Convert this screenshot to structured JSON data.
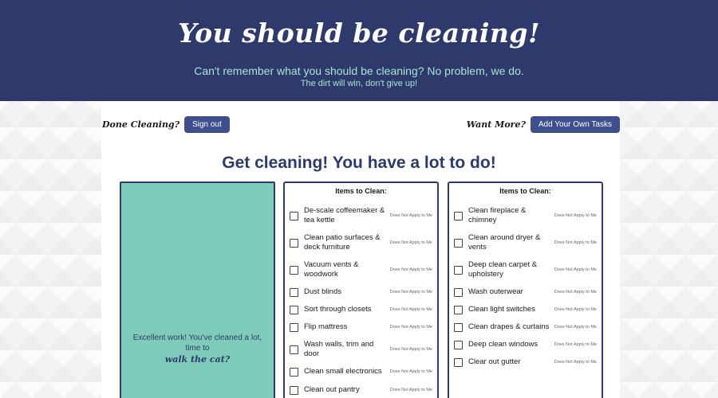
{
  "header": {
    "title": "You should be cleaning!",
    "subtitle": "Can't remember what you should be cleaning? No problem, we do.",
    "tagline": "The dirt will win, don't give up!"
  },
  "actions": {
    "done_label": "Done Cleaning?",
    "sign_out_label": "Sign out",
    "want_more_label": "Want More?",
    "add_tasks_label": "Add Your Own Tasks"
  },
  "main": {
    "heading": "Get cleaning! You have a lot to do!"
  },
  "progress_panel": {
    "message": "Excellent work! You've cleaned a lot, time to",
    "cta": "walk the cat?"
  },
  "lists": [
    {
      "title": "Items to Clean:",
      "items": [
        {
          "label": "De-scale coffeemaker & tea kettle",
          "option": "Does Not Apply to Me"
        },
        {
          "label": "Clean patio surfaces & deck furniture",
          "option": "Does Not Apply to Me"
        },
        {
          "label": "Vacuum vents & woodwork",
          "option": "Does Not Apply to Me"
        },
        {
          "label": "Dust blinds",
          "option": "Does Not Apply to Me"
        },
        {
          "label": "Sort through closets",
          "option": "Does Not Apply to Me"
        },
        {
          "label": "Flip mattress",
          "option": "Does Not Apply to Me"
        },
        {
          "label": "Wash walls, trim and door",
          "option": "Does Not Apply to Me"
        },
        {
          "label": "Clean small electronics",
          "option": "Does Not Apply to Me"
        },
        {
          "label": "Clean out pantry",
          "option": "Does Not Apply to Me"
        }
      ]
    },
    {
      "title": "Items to Clean:",
      "items": [
        {
          "label": "Clean fireplace & chimney",
          "option": "Does Not Apply to Me"
        },
        {
          "label": "Clean around dryer & vents",
          "option": "Does Not Apply to Me"
        },
        {
          "label": "Deep clean carpet & upholstery",
          "option": "Does Not Apply to Me"
        },
        {
          "label": "Wash outerwear",
          "option": "Does Not Apply to Me"
        },
        {
          "label": "Clean light switches",
          "option": "Does Not Apply to Me"
        },
        {
          "label": "Clean drapes & curtains",
          "option": "Does Not Apply to Me"
        },
        {
          "label": "Deep clean windows",
          "option": "Does Not Apply to Me"
        },
        {
          "label": "Clear out gutter",
          "option": "Does Not Apply to Me"
        }
      ]
    }
  ],
  "colors": {
    "navy": "#2d3a6b",
    "button": "#3f4f8e",
    "mint": "#7ecbb9",
    "subtitle_text": "#a9e3d4"
  }
}
